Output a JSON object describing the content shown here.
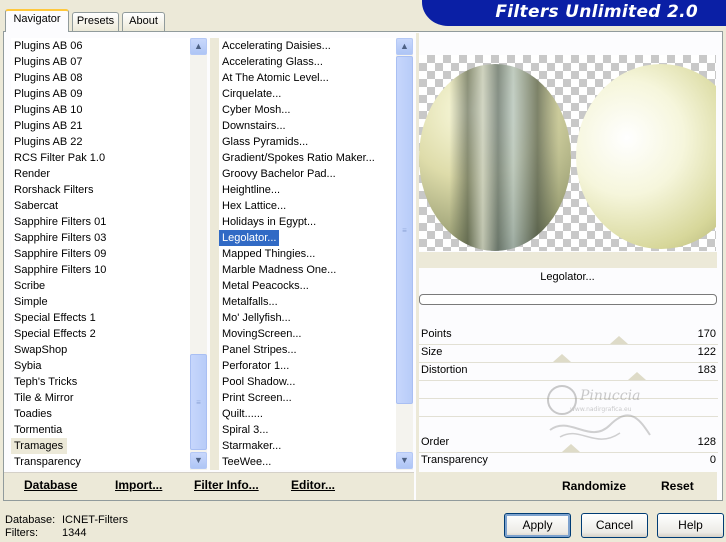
{
  "tabs": [
    {
      "label": "Navigator",
      "active": true
    },
    {
      "label": "Presets",
      "active": false
    },
    {
      "label": "About",
      "active": false
    }
  ],
  "title": "Filters Unlimited 2.0",
  "categories": {
    "items": [
      "Plugins AB 06",
      "Plugins AB 07",
      "Plugins AB 08",
      "Plugins AB 09",
      "Plugins AB 10",
      "Plugins AB 21",
      "Plugins AB 22",
      "RCS Filter Pak 1.0",
      "Render",
      "Rorshack Filters",
      "Sabercat",
      "Sapphire Filters 01",
      "Sapphire Filters 03",
      "Sapphire Filters 09",
      "Sapphire Filters 10",
      "Scribe",
      "Simple",
      "Special Effects 1",
      "Special Effects 2",
      "SwapShop",
      "Sybia",
      "Teph's Tricks",
      "Tile & Mirror",
      "Toadies",
      "Tormentia",
      "Tramages",
      "Transparency"
    ],
    "highlighted": "Tramages"
  },
  "filters": {
    "items": [
      "Accelerating Daisies...",
      "Accelerating Glass...",
      "At The Atomic Level...",
      "Cirquelate...",
      "Cyber Mosh...",
      "Downstairs...",
      "Glass Pyramids...",
      "Gradient/Spokes Ratio Maker...",
      "Groovy Bachelor Pad...",
      "Heightline...",
      "Hex Lattice...",
      "Holidays in Egypt...",
      "Legolator...",
      "Mapped Thingies...",
      "Marble Madness One...",
      "Metal Peacocks...",
      "Metalfalls...",
      "Mo' Jellyfish...",
      "MovingScreen...",
      "Panel Stripes...",
      "Perforator 1...",
      "Pool Shadow...",
      "Print Screen...",
      "Quilt......",
      "Spiral 3...",
      "Starmaker...",
      "TeeWee..."
    ],
    "selected": "Legolator..."
  },
  "list_buttons": {
    "database": "Database",
    "import": "Import...",
    "filter_info": "Filter Info...",
    "editor": "Editor..."
  },
  "effect_name": "Legolator...",
  "params": [
    {
      "label": "Points",
      "value": "170"
    },
    {
      "label": "Size",
      "value": "122"
    },
    {
      "label": "Distortion",
      "value": "183"
    },
    {
      "label": "Order",
      "value": "128"
    },
    {
      "label": "Transparency",
      "value": "0"
    }
  ],
  "watermark_text": "Pinuccia",
  "watermark_url": "www.nadirgrafica.eu",
  "preview_buttons": {
    "randomize": "Randomize",
    "reset": "Reset"
  },
  "status": {
    "database_label": "Database:",
    "database_value": "ICNET-Filters",
    "filters_label": "Filters:",
    "filters_value": "1344"
  },
  "dialog": {
    "apply": "Apply",
    "cancel": "Cancel",
    "help": "Help"
  },
  "colors": {
    "title_bg": "#0a1fa5",
    "selection": "#316ac5",
    "tab_accent": "#ffc83c"
  }
}
